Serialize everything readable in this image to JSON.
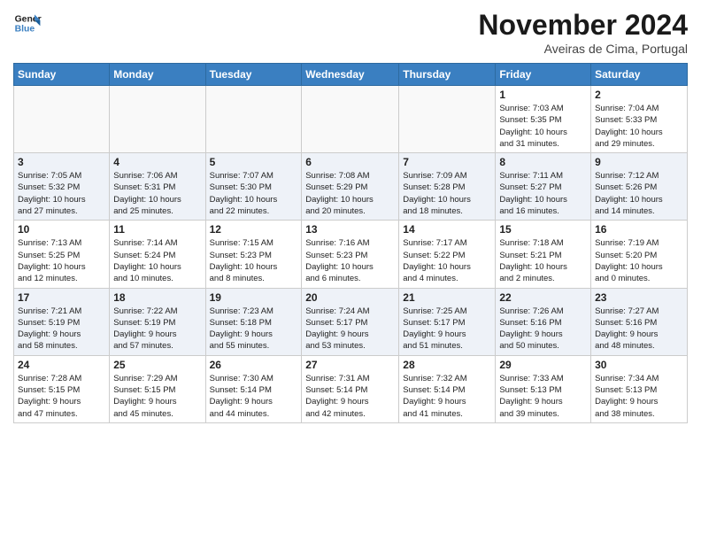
{
  "header": {
    "logo_line1": "General",
    "logo_line2": "Blue",
    "month": "November 2024",
    "location": "Aveiras de Cima, Portugal"
  },
  "weekdays": [
    "Sunday",
    "Monday",
    "Tuesday",
    "Wednesday",
    "Thursday",
    "Friday",
    "Saturday"
  ],
  "weeks": [
    [
      {
        "day": "",
        "info": ""
      },
      {
        "day": "",
        "info": ""
      },
      {
        "day": "",
        "info": ""
      },
      {
        "day": "",
        "info": ""
      },
      {
        "day": "",
        "info": ""
      },
      {
        "day": "1",
        "info": "Sunrise: 7:03 AM\nSunset: 5:35 PM\nDaylight: 10 hours\nand 31 minutes."
      },
      {
        "day": "2",
        "info": "Sunrise: 7:04 AM\nSunset: 5:33 PM\nDaylight: 10 hours\nand 29 minutes."
      }
    ],
    [
      {
        "day": "3",
        "info": "Sunrise: 7:05 AM\nSunset: 5:32 PM\nDaylight: 10 hours\nand 27 minutes."
      },
      {
        "day": "4",
        "info": "Sunrise: 7:06 AM\nSunset: 5:31 PM\nDaylight: 10 hours\nand 25 minutes."
      },
      {
        "day": "5",
        "info": "Sunrise: 7:07 AM\nSunset: 5:30 PM\nDaylight: 10 hours\nand 22 minutes."
      },
      {
        "day": "6",
        "info": "Sunrise: 7:08 AM\nSunset: 5:29 PM\nDaylight: 10 hours\nand 20 minutes."
      },
      {
        "day": "7",
        "info": "Sunrise: 7:09 AM\nSunset: 5:28 PM\nDaylight: 10 hours\nand 18 minutes."
      },
      {
        "day": "8",
        "info": "Sunrise: 7:11 AM\nSunset: 5:27 PM\nDaylight: 10 hours\nand 16 minutes."
      },
      {
        "day": "9",
        "info": "Sunrise: 7:12 AM\nSunset: 5:26 PM\nDaylight: 10 hours\nand 14 minutes."
      }
    ],
    [
      {
        "day": "10",
        "info": "Sunrise: 7:13 AM\nSunset: 5:25 PM\nDaylight: 10 hours\nand 12 minutes."
      },
      {
        "day": "11",
        "info": "Sunrise: 7:14 AM\nSunset: 5:24 PM\nDaylight: 10 hours\nand 10 minutes."
      },
      {
        "day": "12",
        "info": "Sunrise: 7:15 AM\nSunset: 5:23 PM\nDaylight: 10 hours\nand 8 minutes."
      },
      {
        "day": "13",
        "info": "Sunrise: 7:16 AM\nSunset: 5:23 PM\nDaylight: 10 hours\nand 6 minutes."
      },
      {
        "day": "14",
        "info": "Sunrise: 7:17 AM\nSunset: 5:22 PM\nDaylight: 10 hours\nand 4 minutes."
      },
      {
        "day": "15",
        "info": "Sunrise: 7:18 AM\nSunset: 5:21 PM\nDaylight: 10 hours\nand 2 minutes."
      },
      {
        "day": "16",
        "info": "Sunrise: 7:19 AM\nSunset: 5:20 PM\nDaylight: 10 hours\nand 0 minutes."
      }
    ],
    [
      {
        "day": "17",
        "info": "Sunrise: 7:21 AM\nSunset: 5:19 PM\nDaylight: 9 hours\nand 58 minutes."
      },
      {
        "day": "18",
        "info": "Sunrise: 7:22 AM\nSunset: 5:19 PM\nDaylight: 9 hours\nand 57 minutes."
      },
      {
        "day": "19",
        "info": "Sunrise: 7:23 AM\nSunset: 5:18 PM\nDaylight: 9 hours\nand 55 minutes."
      },
      {
        "day": "20",
        "info": "Sunrise: 7:24 AM\nSunset: 5:17 PM\nDaylight: 9 hours\nand 53 minutes."
      },
      {
        "day": "21",
        "info": "Sunrise: 7:25 AM\nSunset: 5:17 PM\nDaylight: 9 hours\nand 51 minutes."
      },
      {
        "day": "22",
        "info": "Sunrise: 7:26 AM\nSunset: 5:16 PM\nDaylight: 9 hours\nand 50 minutes."
      },
      {
        "day": "23",
        "info": "Sunrise: 7:27 AM\nSunset: 5:16 PM\nDaylight: 9 hours\nand 48 minutes."
      }
    ],
    [
      {
        "day": "24",
        "info": "Sunrise: 7:28 AM\nSunset: 5:15 PM\nDaylight: 9 hours\nand 47 minutes."
      },
      {
        "day": "25",
        "info": "Sunrise: 7:29 AM\nSunset: 5:15 PM\nDaylight: 9 hours\nand 45 minutes."
      },
      {
        "day": "26",
        "info": "Sunrise: 7:30 AM\nSunset: 5:14 PM\nDaylight: 9 hours\nand 44 minutes."
      },
      {
        "day": "27",
        "info": "Sunrise: 7:31 AM\nSunset: 5:14 PM\nDaylight: 9 hours\nand 42 minutes."
      },
      {
        "day": "28",
        "info": "Sunrise: 7:32 AM\nSunset: 5:14 PM\nDaylight: 9 hours\nand 41 minutes."
      },
      {
        "day": "29",
        "info": "Sunrise: 7:33 AM\nSunset: 5:13 PM\nDaylight: 9 hours\nand 39 minutes."
      },
      {
        "day": "30",
        "info": "Sunrise: 7:34 AM\nSunset: 5:13 PM\nDaylight: 9 hours\nand 38 minutes."
      }
    ]
  ]
}
